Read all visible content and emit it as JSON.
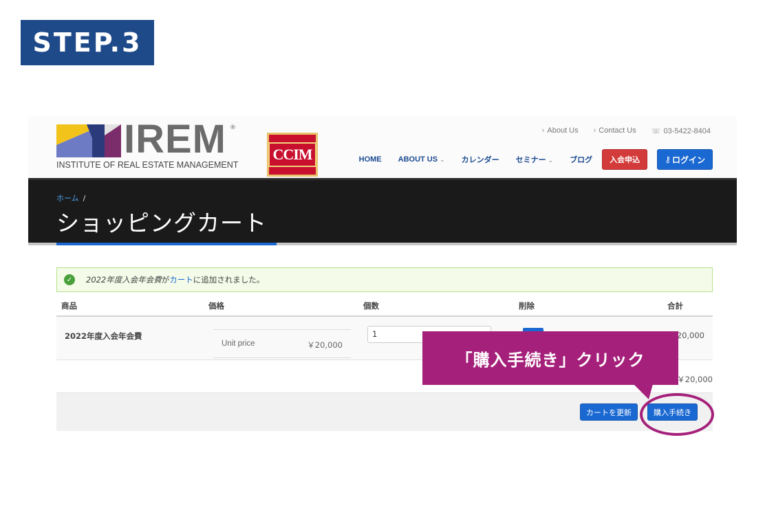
{
  "step_label": "STEP.3",
  "header": {
    "logo_word": "IREM",
    "logo_reg": "®",
    "logo_subtitle": "INSTITUTE OF REAL ESTATE MANAGEMENT",
    "partner_logo": "CCIM",
    "util_links": [
      "About Us",
      "Contact Us"
    ],
    "phone": "03-5422-8404",
    "nav": [
      {
        "label": "HOME",
        "dropdown": false
      },
      {
        "label": "ABOUT US",
        "dropdown": true
      },
      {
        "label": "カレンダー",
        "dropdown": false
      },
      {
        "label": "セミナー",
        "dropdown": true
      },
      {
        "label": "ブログ",
        "dropdown": false
      }
    ],
    "join_button": "入会申込",
    "login_button": "ログイン"
  },
  "banner": {
    "breadcrumb_home": "ホーム",
    "breadcrumb_sep": "/",
    "title": "ショッピングカート"
  },
  "notice": {
    "product": "2022年度入会年会費",
    "middle": " が",
    "link": "カート",
    "suffix": "に追加されました。"
  },
  "table": {
    "headers": [
      "商品",
      "価格",
      "個数",
      "削除",
      "合計"
    ],
    "rows": [
      {
        "product": "2022年度入会年会費",
        "price_label": "Unit price",
        "price": "￥20,000",
        "qty": "1",
        "total": "20,000"
      }
    ],
    "grand_total": "￥20,000"
  },
  "buttons": {
    "update_cart": "カートを更新",
    "checkout": "購入手続き"
  },
  "annotation": {
    "callout": "「購入手続き」クリック"
  },
  "colors": {
    "step_badge": "#1f4a8a",
    "accent_blue": "#1a68d1",
    "join_red": "#d33a3a",
    "callout_magenta": "#a5207a"
  }
}
